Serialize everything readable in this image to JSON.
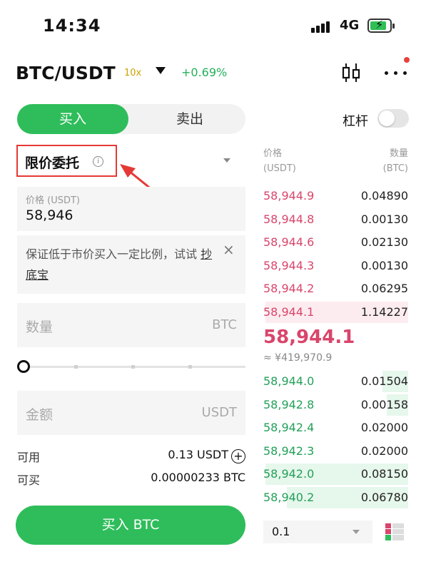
{
  "status": {
    "time": "14:34",
    "network": "4G"
  },
  "header": {
    "pair": "BTC/USDT",
    "leverage": "10x",
    "change": "+0.69%"
  },
  "tabs": {
    "buy": "买入",
    "sell": "卖出"
  },
  "margin_toggle": {
    "label": "杠杆",
    "on": false
  },
  "order_type": {
    "label": "限价委托",
    "info": "i"
  },
  "price_field": {
    "label": "价格 (USDT)",
    "value": "58,946"
  },
  "tip": {
    "text": "保证低于市价买入一定比例，试试 ",
    "link": "抄底宝",
    "close": "×"
  },
  "quantity_field": {
    "placeholder": "数量",
    "unit": "BTC"
  },
  "slider": {
    "fraction": 0
  },
  "amount_field": {
    "placeholder": "金额",
    "unit": "USDT"
  },
  "balance": {
    "available_label": "可用",
    "available_value": "0.13 USDT",
    "plus": "+",
    "buyable_label": "可买",
    "buyable_value": "0.00000233 BTC"
  },
  "buy_button": {
    "label": "买入 BTC"
  },
  "order_book": {
    "price_header": [
      "价格",
      "(USDT)"
    ],
    "qty_header": [
      "数量",
      "(BTC)"
    ],
    "asks": [
      {
        "price": "58,944.9",
        "qty": "0.04890"
      },
      {
        "price": "58,944.8",
        "qty": "0.00130"
      },
      {
        "price": "58,944.6",
        "qty": "0.02130"
      },
      {
        "price": "58,944.3",
        "qty": "0.00130"
      },
      {
        "price": "58,944.2",
        "qty": "0.06295"
      },
      {
        "price": "58,944.1",
        "qty": "1.14227"
      }
    ],
    "last_price": "58,944.1",
    "last_price_cny": "≈ ¥419,970.9",
    "bids": [
      {
        "price": "58,944.0",
        "qty": "0.01504"
      },
      {
        "price": "58,942.8",
        "qty": "0.00158"
      },
      {
        "price": "58,942.4",
        "qty": "0.02000"
      },
      {
        "price": "58,942.3",
        "qty": "0.02000"
      },
      {
        "price": "58,942.0",
        "qty": "0.08150"
      },
      {
        "price": "58,940.2",
        "qty": "0.06780"
      }
    ],
    "depth": "0.1"
  },
  "colors": {
    "buy": "#2ebd5a",
    "ask": "#d9456b",
    "bid": "#23a05a",
    "leverage": "#c9a400"
  }
}
